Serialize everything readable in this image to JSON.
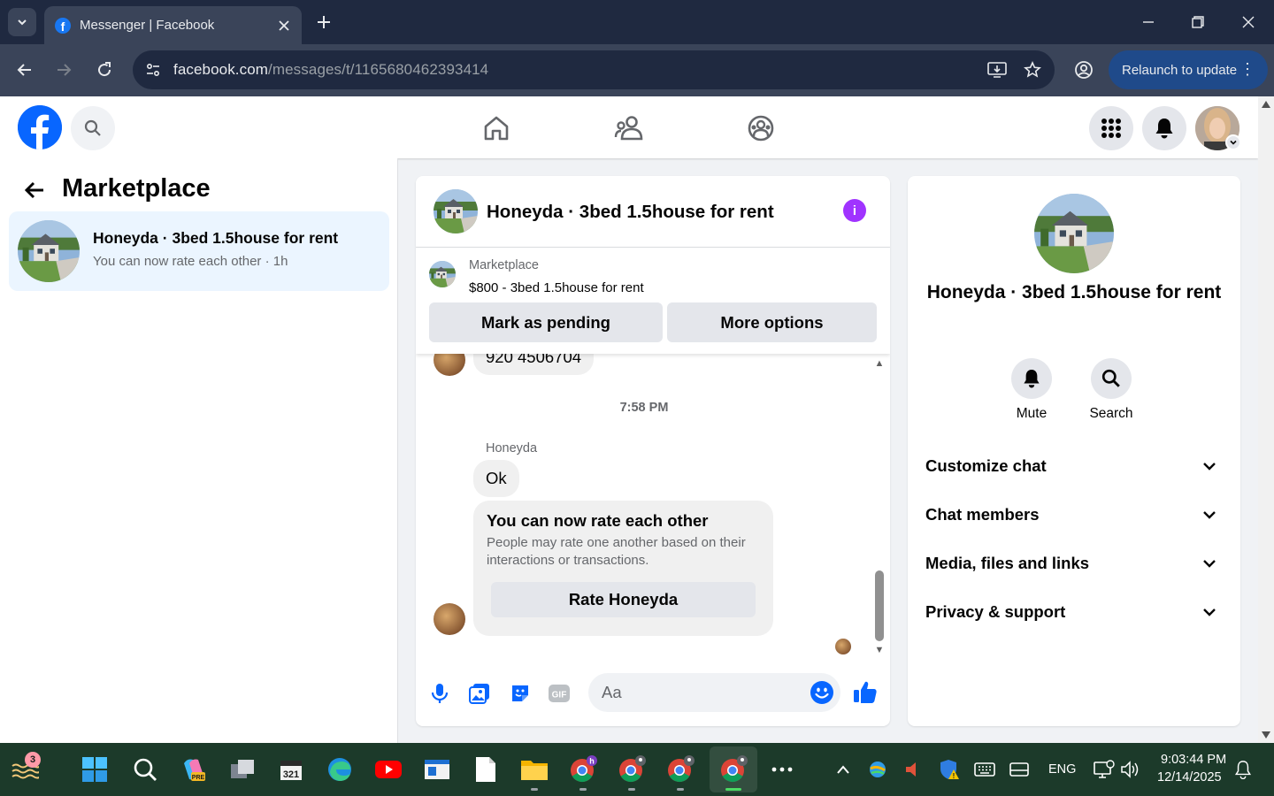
{
  "browser": {
    "tab_title": "Messenger | Facebook",
    "url_host": "facebook.com",
    "url_path": "/messages/t/1165680462393414",
    "relaunch_label": "Relaunch to update"
  },
  "left_panel": {
    "title": "Marketplace",
    "thread": {
      "name": "Honeyda · 3bed 1.5house for rent",
      "preview": "You can now rate each other · 1h"
    }
  },
  "chat": {
    "header_name": "Honeyda · 3bed 1.5house for rent",
    "marketplace": {
      "label": "Marketplace",
      "listing": "$800 - 3bed 1.5house for rent",
      "mark_pending_label": "Mark as pending",
      "more_options_label": "More options"
    },
    "messages": {
      "partial_bubble": "920 4506704",
      "timestamp": "7:58 PM",
      "sender": "Honeyda",
      "ok_bubble": "Ok",
      "rate_title": "You can now rate each other",
      "rate_desc": "People may rate one another based on their interactions or transactions.",
      "rate_button": "Rate Honeyda"
    },
    "composer_placeholder": "Aa"
  },
  "info_panel": {
    "name": "Honeyda · 3bed 1.5house for rent",
    "mute_label": "Mute",
    "search_label": "Search",
    "sections": [
      "Customize chat",
      "Chat members",
      "Media, files and links",
      "Privacy & support"
    ]
  },
  "taskbar": {
    "widget_badge": "3",
    "chrome_badge": "h",
    "language": "ENG",
    "time": "9:03:44 PM",
    "date": "12/14/2025"
  },
  "colors": {
    "fb_blue": "#0866ff",
    "info_purple": "#a033ff",
    "selected_thread": "#ebf5ff"
  }
}
